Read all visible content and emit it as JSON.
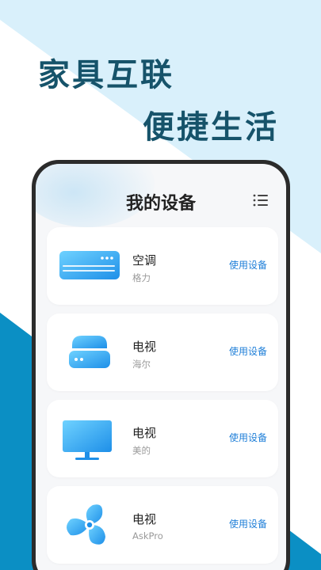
{
  "headline": {
    "line1": "家具互联",
    "line2": "便捷生活"
  },
  "screen": {
    "title": "我的设备",
    "menu_icon": "list-menu-icon"
  },
  "devices": [
    {
      "name": "空调",
      "brand": "格力",
      "action": "使用设备",
      "icon": "air-conditioner-icon"
    },
    {
      "name": "电视",
      "brand": "海尔",
      "action": "使用设备",
      "icon": "set-top-box-icon"
    },
    {
      "name": "电视",
      "brand": "美的",
      "action": "使用设备",
      "icon": "monitor-icon"
    },
    {
      "name": "电视",
      "brand": "AskPro",
      "action": "使用设备",
      "icon": "fan-icon"
    }
  ],
  "colors": {
    "headline": "#16536a",
    "accent_blue": "#1f7fd8",
    "bg_light": "#d9f0fb",
    "bg_dark": "#0b8fc4"
  }
}
